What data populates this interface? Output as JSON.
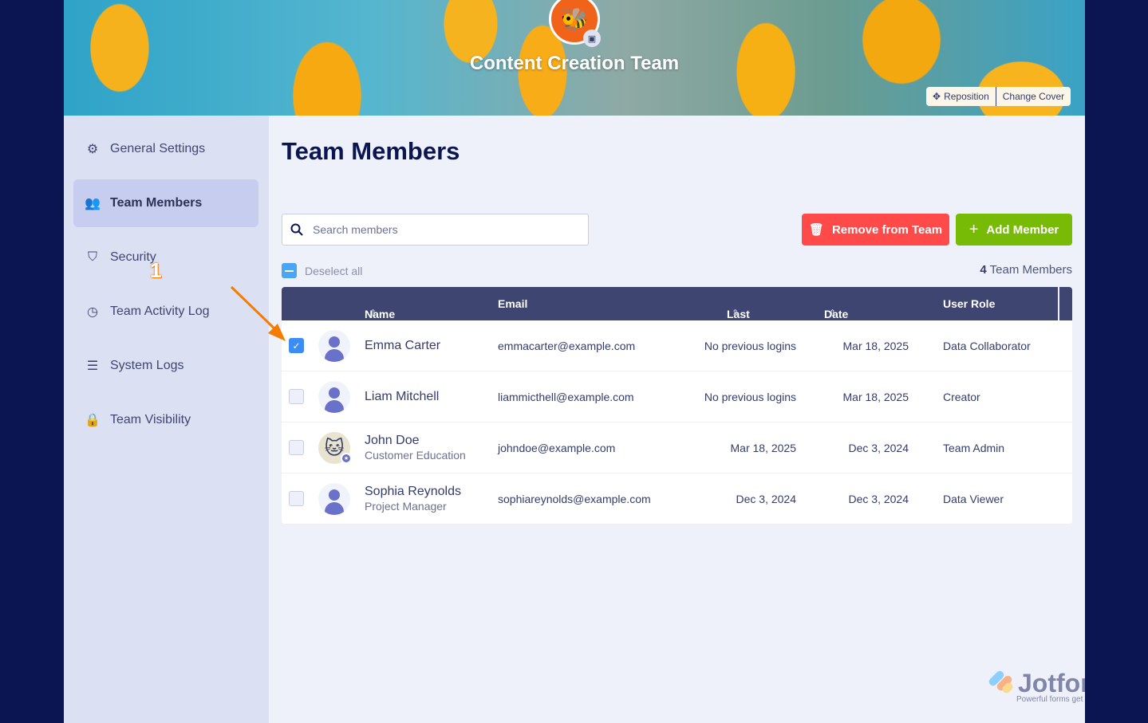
{
  "banner": {
    "team_name": "Content Creation Team",
    "logo_icon": "bee-icon",
    "reposition_label": "Reposition",
    "change_cover_label": "Change Cover"
  },
  "sidebar": {
    "items": [
      {
        "label": "General Settings",
        "icon": "gear-icon"
      },
      {
        "label": "Team Members",
        "icon": "users-icon",
        "active": true
      },
      {
        "label": "Security",
        "icon": "shield-icon"
      },
      {
        "label": "Team Activity Log",
        "icon": "history-icon"
      },
      {
        "label": "System Logs",
        "icon": "database-icon"
      },
      {
        "label": "Team Visibility",
        "icon": "lock-icon"
      }
    ]
  },
  "main": {
    "title": "Team Members",
    "search_placeholder": "Search members",
    "remove_label": "Remove from Team",
    "add_label": "Add Member",
    "deselect_label": "Deselect all",
    "count": "4",
    "count_label": "Team Members",
    "columns": [
      "Name",
      "Email",
      "Last Login",
      "Date Created",
      "User Role"
    ],
    "rows": [
      {
        "name": "Emma Carter",
        "subtitle": "",
        "email": "emmacarter@example.com",
        "last_login": "No previous logins",
        "date_created": "Mar 18, 2025",
        "role": "Data Collaborator",
        "checked": true
      },
      {
        "name": "Liam Mitchell",
        "subtitle": "",
        "email": "liammicthell@example.com",
        "last_login": "No previous logins",
        "date_created": "Mar 18, 2025",
        "role": "Creator",
        "checked": false
      },
      {
        "name": "John Doe",
        "subtitle": "Customer Education",
        "email": "johndoe@example.com",
        "last_login": "Mar 18, 2025",
        "date_created": "Dec 3, 2024",
        "role": "Team Admin",
        "checked": false
      },
      {
        "name": "Sophia Reynolds",
        "subtitle": "Project Manager",
        "email": "sophiareynolds@example.com",
        "last_login": "Dec 3, 2024",
        "date_created": "Dec 3, 2024",
        "role": "Data Viewer",
        "checked": false
      }
    ]
  },
  "annotation": {
    "number": "1",
    "color": "#f57c00"
  },
  "watermark": {
    "brand": "Jotform",
    "tagline": "Powerful forms get it done"
  },
  "colors": {
    "remove": "#ff4a4a",
    "add": "#78bb07",
    "header": "#3e4570",
    "accent": "#3b8cf5"
  }
}
